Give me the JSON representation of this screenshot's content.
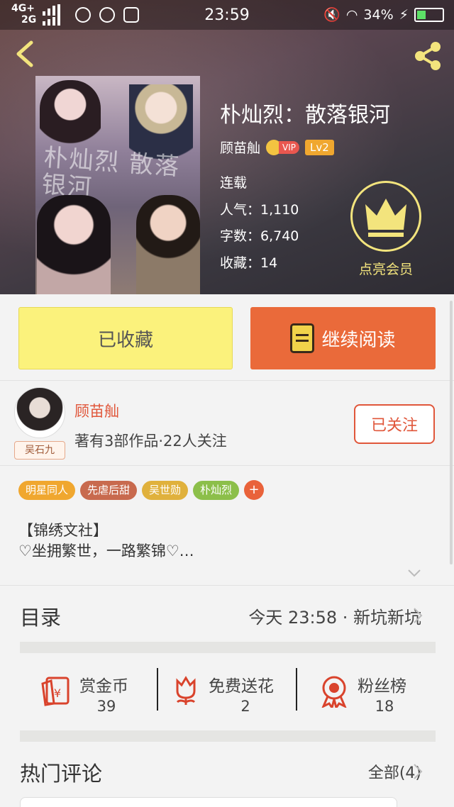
{
  "status_bar": {
    "network_top": "4G+",
    "network_bottom": "2G",
    "time": "23:59",
    "battery": "34%"
  },
  "book": {
    "title": "朴灿烈：散落银河",
    "author": "顾苗舢",
    "vip_label": "VIP",
    "level": "Lv2",
    "status": "连载",
    "popularity": "人气：1,110",
    "word_count": "字数：6,740",
    "favorites": "收藏：14",
    "cover_title": "朴灿烈 散落银河"
  },
  "member_button": {
    "label": "点亮会员"
  },
  "actions": {
    "favorited_label": "已收藏",
    "continue_label": "继续阅读"
  },
  "author_card": {
    "name": "顾苗舢",
    "avatar_tag": "吴石九",
    "info": "著有3部作品·22人关注",
    "follow_label": "已关注"
  },
  "tags": [
    {
      "label": "明星同人",
      "color": "#f0a72f"
    },
    {
      "label": "先虐后甜",
      "color": "#c86a4e"
    },
    {
      "label": "吴世勋",
      "color": "#e0b13c"
    },
    {
      "label": "朴灿烈",
      "color": "#8cbf4a"
    }
  ],
  "tag_more": "+",
  "description": {
    "line1": "【锦绣文社】",
    "line2": "♡坐拥繁世，一路繁锦♡…"
  },
  "toc": {
    "title": "目录",
    "latest": "今天 23:58 · 新坑新坑"
  },
  "stats": [
    {
      "label": "赏金币",
      "value": "39",
      "icon": "red-envelope-icon"
    },
    {
      "label": "免费送花",
      "value": "2",
      "icon": "flower-icon"
    },
    {
      "label": "粉丝榜",
      "value": "18",
      "icon": "medal-icon"
    }
  ],
  "comments": {
    "title": "热门评论",
    "all_label": "全部(4)"
  },
  "colors": {
    "accent_orange": "#ea6a3a",
    "fav_yellow": "#fbf27c",
    "crown_yellow": "#f3e47d",
    "author_red": "#e0563a"
  }
}
